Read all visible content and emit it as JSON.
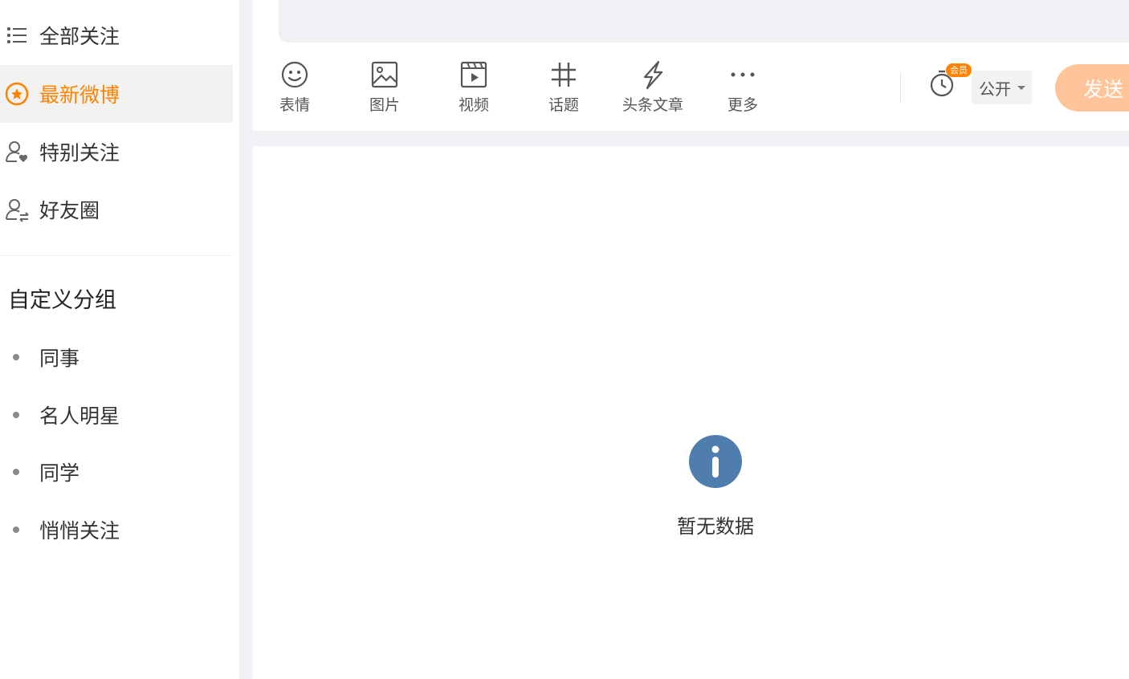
{
  "sidebar": {
    "items": [
      {
        "label": "全部关注",
        "icon": "list-icon"
      },
      {
        "label": "最新微博",
        "icon": "star-circle-icon",
        "active": true
      },
      {
        "label": "特别关注",
        "icon": "user-heart-icon"
      },
      {
        "label": "好友圈",
        "icon": "user-friends-icon"
      }
    ],
    "group_title": "自定义分组",
    "groups": [
      "同事",
      "名人明星",
      "同学",
      "悄悄关注"
    ]
  },
  "composer": {
    "tools": [
      {
        "label": "表情",
        "icon": "smile-icon"
      },
      {
        "label": "图片",
        "icon": "image-icon"
      },
      {
        "label": "视频",
        "icon": "video-icon"
      },
      {
        "label": "话题",
        "icon": "hashtag-icon"
      },
      {
        "label": "头条文章",
        "icon": "lightning-icon"
      },
      {
        "label": "更多",
        "icon": "more-dots-icon"
      }
    ],
    "vip_badge": "会员",
    "visibility": "公开",
    "send_label": "发送"
  },
  "feed": {
    "empty_text": "暂无数据"
  },
  "colors": {
    "accent": "#ff8200",
    "send_disabled": "#ffc49a",
    "info_icon": "#4f7eae"
  }
}
